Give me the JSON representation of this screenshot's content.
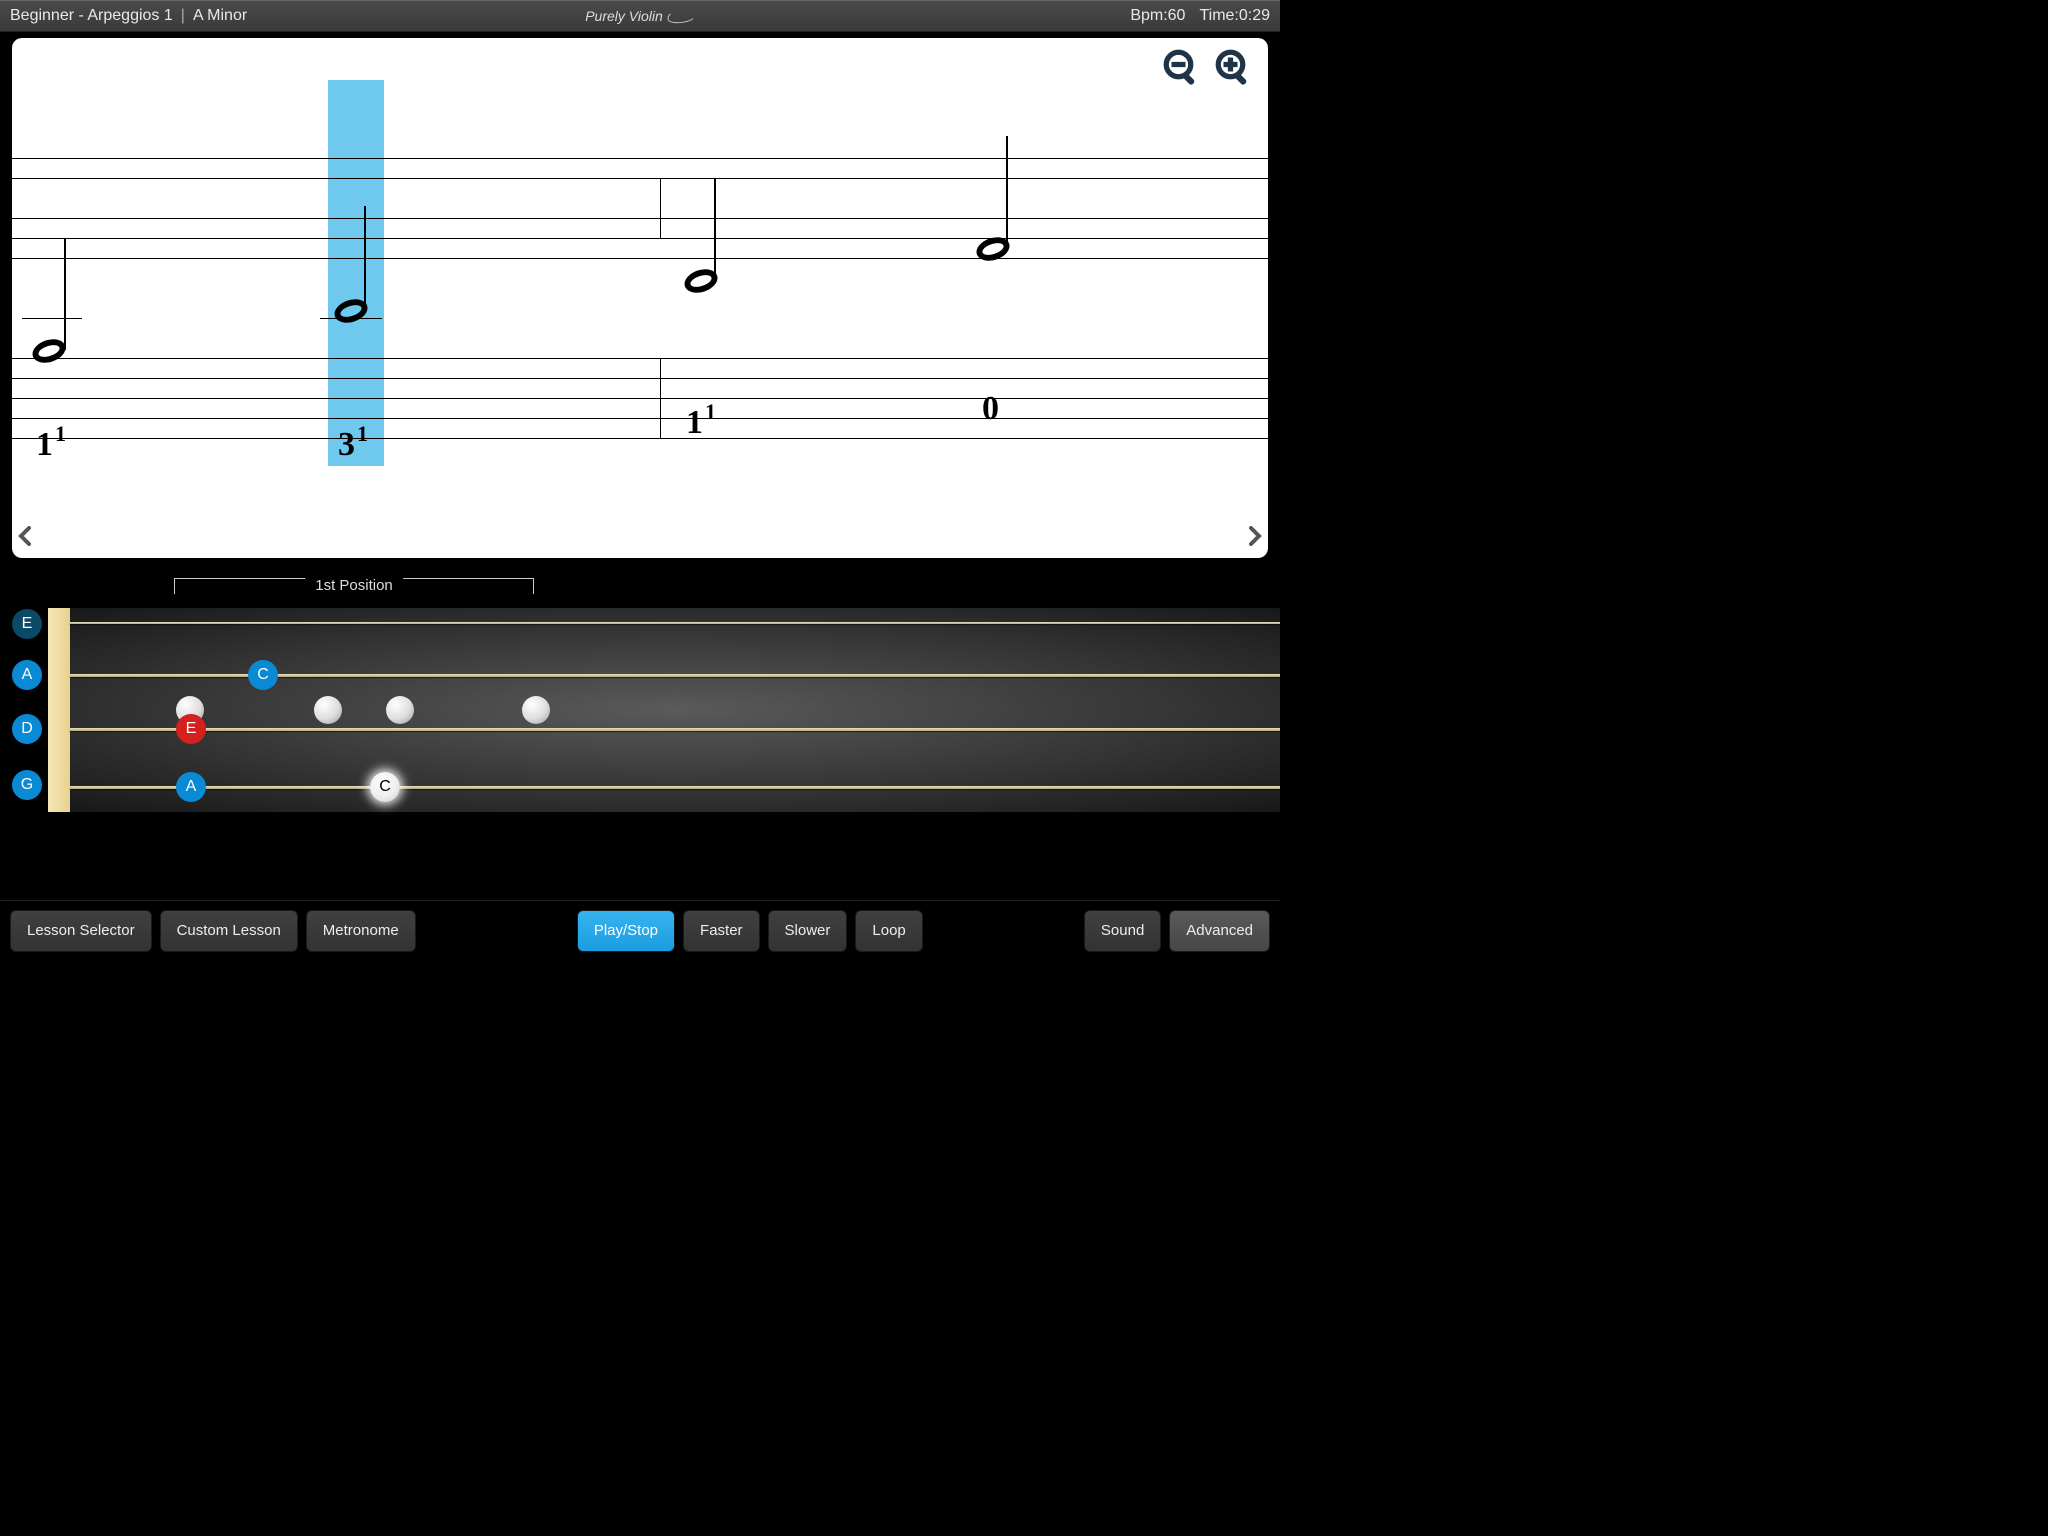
{
  "header": {
    "lesson": "Beginner - Arpeggios 1",
    "key": "A Minor",
    "brand": "Purely Violin",
    "bpm_label": "Bpm:",
    "bpm_value": "60",
    "time_label": "Time:",
    "time_value": "0:29"
  },
  "score": {
    "zoom_out": "zoom-out",
    "zoom_in": "zoom-in",
    "notes": [
      {
        "fingering_main": "1",
        "fingering_sup": "1"
      },
      {
        "fingering_main": "3",
        "fingering_sup": "1",
        "highlighted": true
      },
      {
        "fingering_main": "1",
        "fingering_sup": "1"
      },
      {
        "fingering_main": "0",
        "fingering_sup": ""
      }
    ]
  },
  "fretboard": {
    "position_label": "1st Position",
    "open_strings": [
      "E",
      "A",
      "D",
      "G"
    ],
    "markers": {
      "c_str2": "C",
      "e_str3": "E",
      "a_str4": "A",
      "c_str4": "C"
    }
  },
  "toolbar": {
    "lesson_selector": "Lesson Selector",
    "custom_lesson": "Custom Lesson",
    "metronome": "Metronome",
    "play_stop": "Play/Stop",
    "faster": "Faster",
    "slower": "Slower",
    "loop": "Loop",
    "sound": "Sound",
    "advanced": "Advanced"
  }
}
